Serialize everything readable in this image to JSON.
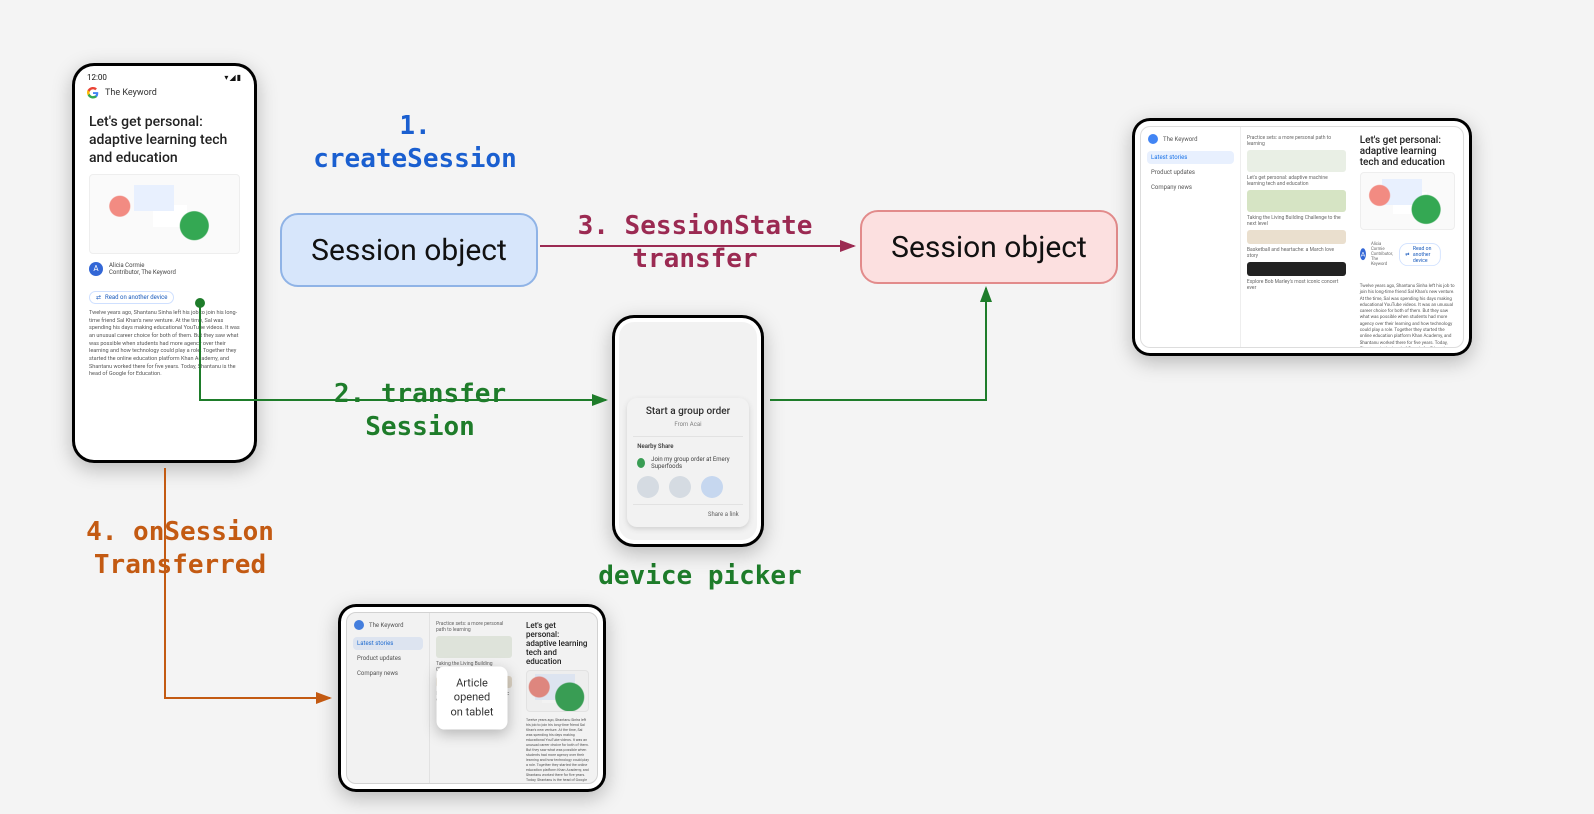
{
  "steps": {
    "s1": "1.\ncreateSession",
    "s2": "2. transfer\nSession",
    "s3": "3. SessionState\ntransfer",
    "s4": "4. onSession\nTransferred",
    "device_picker": "device picker"
  },
  "session_box": "Session object",
  "phone": {
    "clock": "12:00",
    "status_icons": "▾◢▮",
    "app_title": "The Keyword",
    "headline": "Let's get personal: adaptive learning tech and education",
    "author_initial": "A",
    "author_name": "Alicia Cormie",
    "author_role": "Contributor, The Keyword",
    "read_on": "Read on another device",
    "body": "Twelve years ago, Shantanu Sinha left his job to join his long-time friend Sal Khan's new venture. At the time, Sal was spending his days making educational YouTube videos. It was an unusual career choice for both of them. But they saw what was possible when students had more agency over their learning and how technology could play a role. Together they started the online education platform Khan Academy, and Shantanu worked there for five years.\n\nToday, Shantanu is the head of Google for Education."
  },
  "picker": {
    "title": "Start a group order",
    "from": "From Acai",
    "nearby": "Nearby Share",
    "invite": "Join my group order at Emery Superfoods",
    "share": "Share a link"
  },
  "tablet": {
    "nav": [
      "Latest stories",
      "Product updates",
      "Company news"
    ],
    "feed_top_title": "Practice sets: a more personal path to learning",
    "feed_items": [
      "Let's get personal: adaptive machine learning tech and education",
      "Taking the Living Building Challenge to the next level",
      "Basketball and heartache: a March love story",
      "Explore Bob Marley's most iconic concert ever"
    ],
    "read_on": "Read on another device"
  },
  "toast": "Article\nopened\non tablet"
}
